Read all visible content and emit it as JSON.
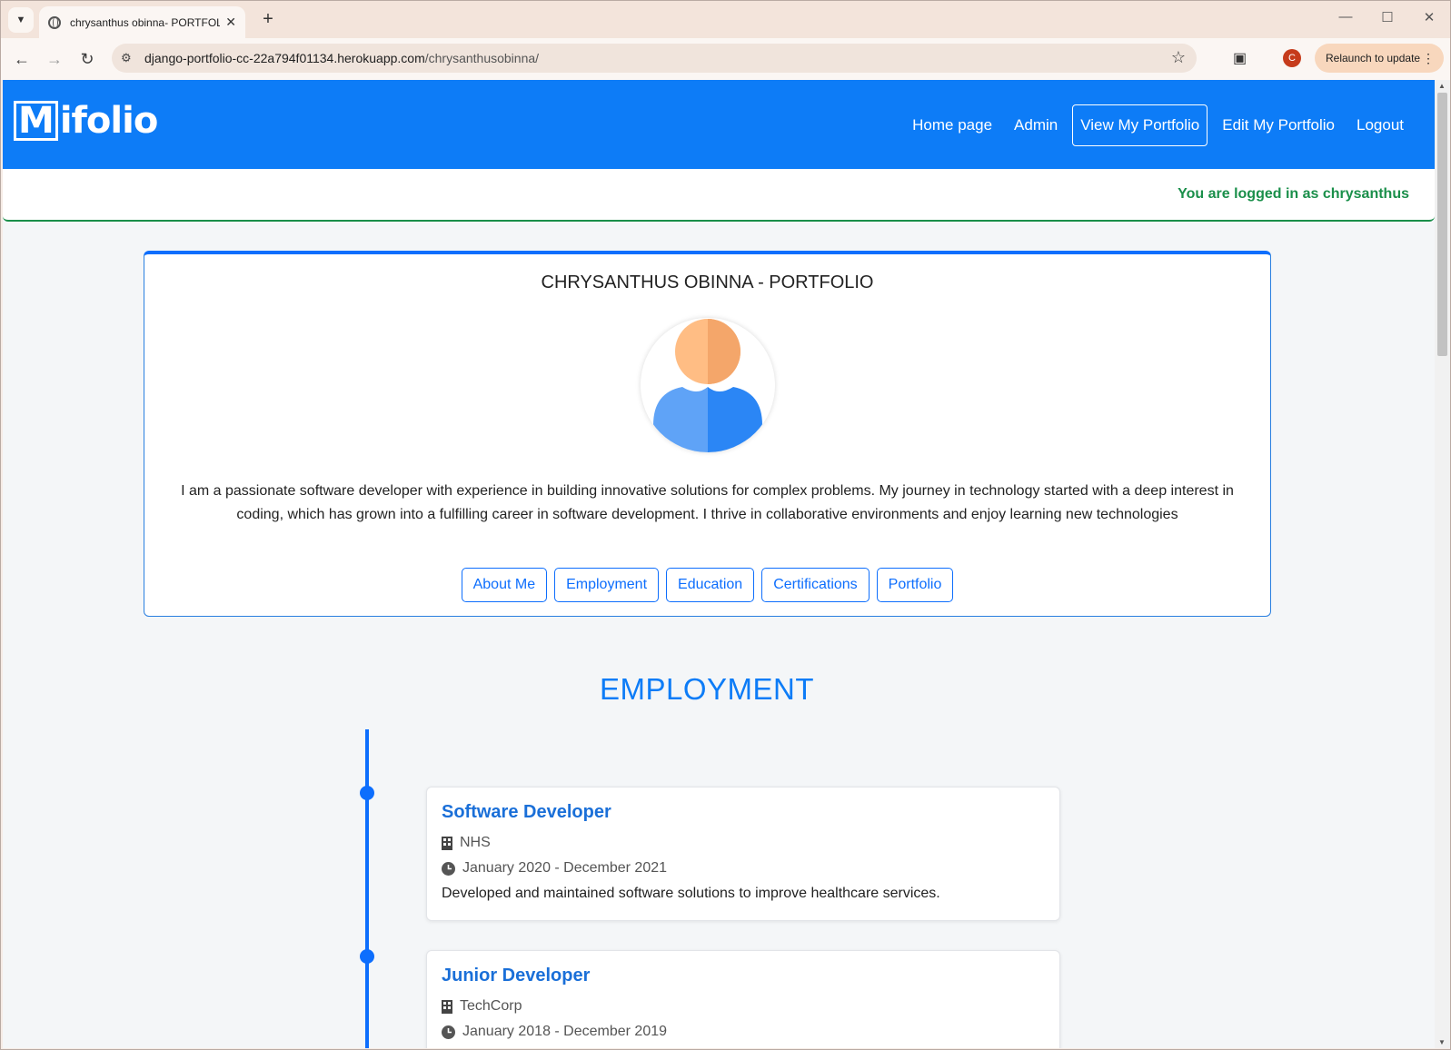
{
  "browser": {
    "tab_title": "chrysanthus obinna- PORTFOLIO",
    "url_host": "django-portfolio-cc-22a794f01134.herokuapp.com",
    "url_path": "/chrysanthusobinna/",
    "profile_initial": "C",
    "relaunch_label": "Relaunch to update"
  },
  "navbar": {
    "logo_initial": "M",
    "logo_rest": "ifolio",
    "links": [
      "Home page",
      "Admin",
      "View My Portfolio",
      "Edit My Portfolio",
      "Logout"
    ]
  },
  "login_status": "You are logged in as chrysanthus",
  "profile": {
    "title": "CHRYSANTHUS OBINNA - PORTFOLIO",
    "bio": "I am a passionate software developer with experience in building innovative solutions for complex problems. My journey in technology started with a deep interest in coding, which has grown into a fulfilling career in software development. I thrive in collaborative environments and enjoy learning new technologies",
    "buttons": [
      "About Me",
      "Employment",
      "Education",
      "Certifications",
      "Portfolio"
    ]
  },
  "employment": {
    "heading": "EMPLOYMENT",
    "jobs": [
      {
        "title": "Software Developer",
        "company": "NHS",
        "period": "January 2020 - December 2021",
        "description": "Developed and maintained software solutions to improve healthcare services."
      },
      {
        "title": "Junior Developer",
        "company": "TechCorp",
        "period": "January 2018 - December 2019",
        "description": ""
      }
    ]
  },
  "colors": {
    "primary": "#0d7cf7",
    "success": "#1a8f4a"
  }
}
